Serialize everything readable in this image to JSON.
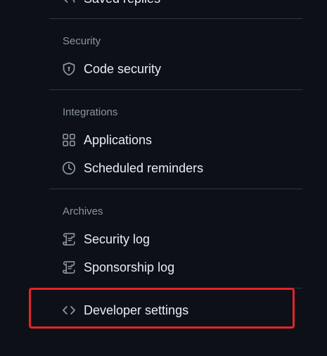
{
  "nav": {
    "top_item": {
      "label": "Saved replies",
      "icon": "reply-icon"
    },
    "groups": [
      {
        "header": "Security",
        "items": [
          {
            "label": "Code security",
            "icon": "shield-lock-icon"
          }
        ]
      },
      {
        "header": "Integrations",
        "items": [
          {
            "label": "Applications",
            "icon": "apps-grid-icon"
          },
          {
            "label": "Scheduled reminders",
            "icon": "clock-icon"
          }
        ]
      },
      {
        "header": "Archives",
        "items": [
          {
            "label": "Security log",
            "icon": "log-icon"
          },
          {
            "label": "Sponsorship log",
            "icon": "log-icon"
          }
        ]
      }
    ],
    "bottom_item": {
      "label": "Developer settings",
      "icon": "code-icon"
    }
  },
  "colors": {
    "background": "#0d1117",
    "text": "#e6edf3",
    "muted_text": "#8b949e",
    "divider": "#30363d",
    "highlight": "#e5232a"
  }
}
